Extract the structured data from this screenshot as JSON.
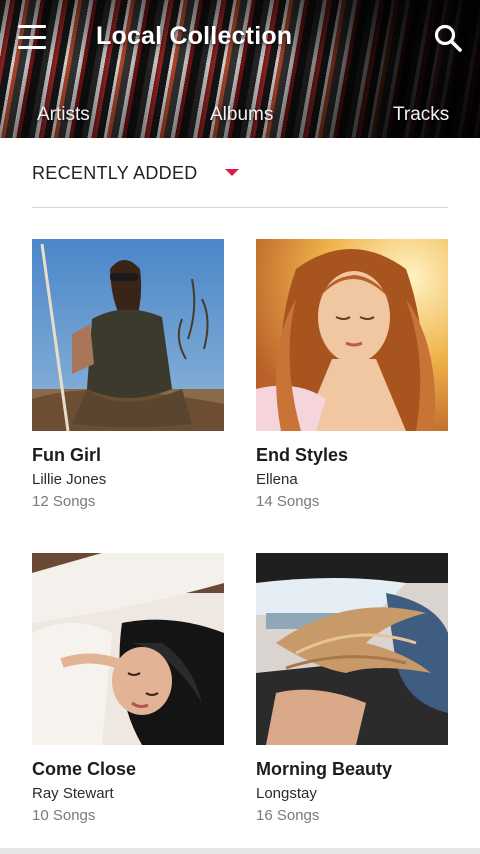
{
  "header": {
    "title": "Local Collection",
    "menu_icon": "hamburger-menu-icon",
    "search_icon": "search-icon",
    "tabs": [
      {
        "label": "Artists"
      },
      {
        "label": "Albums"
      },
      {
        "label": "Tracks"
      }
    ],
    "active_tab": "Albums"
  },
  "sort": {
    "label": "RECENTLY ADDED",
    "caret_icon": "dropdown-caret-icon",
    "accent_color": "#e0194f"
  },
  "albums": [
    {
      "title": "Fun Girl",
      "artist": "Lillie Jones",
      "count": "12 Songs"
    },
    {
      "title": "End Styles",
      "artist": "Ellena",
      "count": "14 Songs"
    },
    {
      "title": "Come Close",
      "artist": "Ray Stewart",
      "count": "10 Songs"
    },
    {
      "title": "Morning Beauty",
      "artist": "Longstay",
      "count": "16 Songs"
    }
  ]
}
